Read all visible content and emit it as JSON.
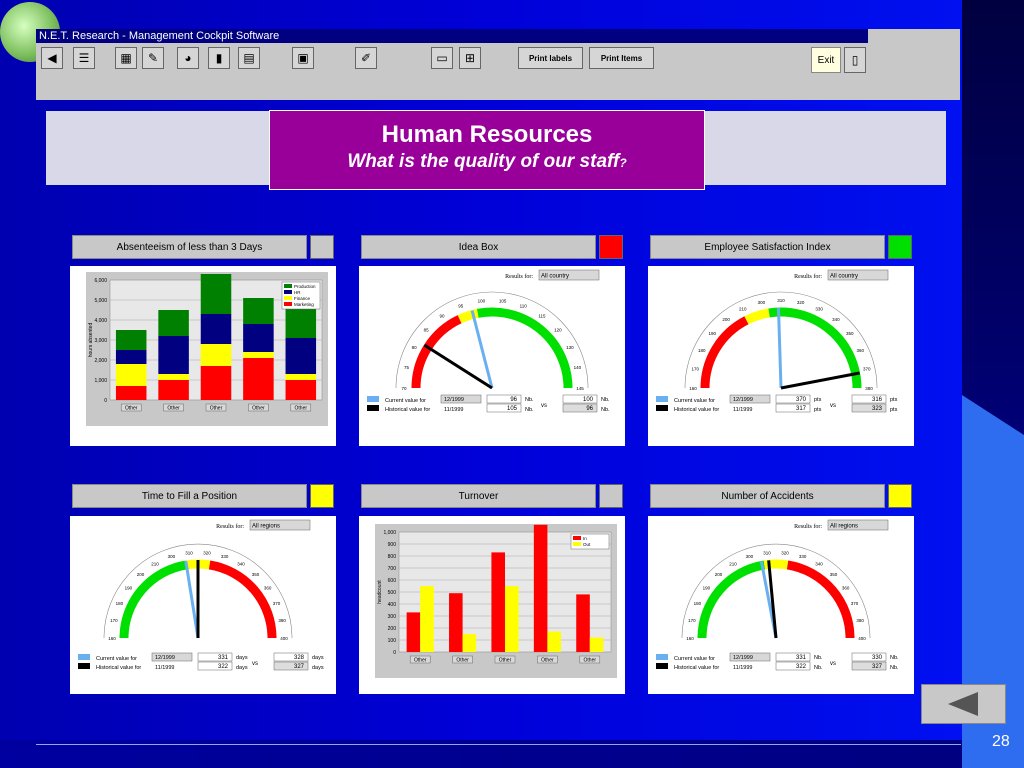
{
  "app": {
    "window_title": "N.E.T. Research - Management Cockpit Software",
    "print_labels": "Print labels",
    "print_items": "Print Items",
    "exit_label": "Exit"
  },
  "slide": {
    "title": "Human Resources",
    "subtitle": "What is the quality of our staff",
    "subtitle_mark": "?",
    "page_number": "28"
  },
  "panels": {
    "absenteeism": {
      "label": "Absenteeism of less than 3 Days",
      "status_color": "#c8c8c8"
    },
    "idea_box": {
      "label": "Idea Box",
      "status_color": "#ff0000"
    },
    "satisfaction": {
      "label": "Employee Satisfaction Index",
      "status_color": "#00e000"
    },
    "time_to_fill": {
      "label": "Time to Fill a Position",
      "status_color": "#ffff00"
    },
    "turnover": {
      "label": "Turnover",
      "status_color": "#c8c8c8"
    },
    "accidents": {
      "label": "Number of Accidents",
      "status_color": "#ffff00"
    }
  },
  "gauges": {
    "idea_box": {
      "results_label": "Results for:",
      "results_value": "All country",
      "ticks": [
        "70",
        "75",
        "80",
        "85",
        "90",
        "95",
        "100",
        "105",
        "110",
        "115",
        "120",
        "130",
        "140",
        "145"
      ],
      "current_label": "Current value for",
      "historical_label": "Historical value for",
      "current_date": "12/1999",
      "historical_date": "11/1999",
      "current_value": "96",
      "historical_value": "105",
      "unit": "Nb.",
      "vs": "vs",
      "compare_current": "100",
      "compare_historical": "96",
      "current_fraction": 0.18,
      "historical_fraction": 0.42
    },
    "satisfaction": {
      "results_label": "Results for:",
      "results_value": "All country",
      "ticks": [
        "160",
        "170",
        "180",
        "190",
        "200",
        "210",
        "300",
        "310",
        "320",
        "330",
        "340",
        "350",
        "360",
        "370",
        "380"
      ],
      "current_label": "Current value for",
      "historical_label": "Historical value for",
      "current_date": "12/1999",
      "historical_date": "11/1999",
      "current_value": "370",
      "historical_value": "317",
      "unit": "pts",
      "vs": "vs",
      "compare_current": "316",
      "compare_historical": "323",
      "current_fraction": 0.94,
      "historical_fraction": 0.49
    },
    "time_to_fill": {
      "results_label": "Results for:",
      "results_value": "All regions",
      "ticks": [
        "160",
        "170",
        "180",
        "190",
        "200",
        "210",
        "300",
        "310",
        "320",
        "330",
        "340",
        "350",
        "360",
        "370",
        "380",
        "400"
      ],
      "current_label": "Current value for",
      "historical_label": "Historical value for",
      "current_date": "12/1999",
      "historical_date": "11/1999",
      "current_value": "331",
      "historical_value": "322",
      "unit": "days",
      "vs": "vs",
      "compare_current": "328",
      "compare_historical": "327",
      "current_fraction": 0.5,
      "historical_fraction": 0.45
    },
    "accidents": {
      "results_label": "Results for:",
      "results_value": "All regions",
      "ticks": [
        "160",
        "170",
        "180",
        "190",
        "200",
        "210",
        "300",
        "310",
        "320",
        "330",
        "340",
        "350",
        "360",
        "370",
        "380",
        "400"
      ],
      "current_label": "Current value for",
      "historical_label": "Historical value for",
      "current_date": "12/1999",
      "historical_date": "11/1999",
      "current_value": "331",
      "historical_value": "322",
      "unit": "Nb.",
      "vs": "vs",
      "compare_current": "330",
      "compare_historical": "327",
      "current_fraction": 0.47,
      "historical_fraction": 0.44
    }
  },
  "chart_data": [
    {
      "type": "bar",
      "stacked": true,
      "ylabel": "hours absented",
      "categories": [
        "Other",
        "Other",
        "Other",
        "Other",
        "Other"
      ],
      "y_ticks": [
        "0",
        "1,000",
        "2,000",
        "3,000",
        "4,000",
        "5,000",
        "6,000"
      ],
      "ylim": [
        0,
        6000
      ],
      "legend_position": "top-right",
      "series": [
        {
          "name": "Marketing",
          "color": "#ff0000",
          "values": [
            700,
            1000,
            1700,
            2100,
            1000
          ]
        },
        {
          "name": "Finance",
          "color": "#ffff00",
          "values": [
            1100,
            300,
            1100,
            300,
            300
          ]
        },
        {
          "name": "HR",
          "color": "#000080",
          "values": [
            700,
            1900,
            1500,
            1400,
            1800
          ]
        },
        {
          "name": "Production",
          "color": "#008000",
          "values": [
            1000,
            1300,
            2000,
            1300,
            1800
          ]
        }
      ]
    },
    {
      "type": "bar",
      "ylabel": "headcount",
      "categories": [
        "Other",
        "Other",
        "Other",
        "Other",
        "Other"
      ],
      "y_ticks": [
        "0",
        "100",
        "200",
        "300",
        "400",
        "500",
        "600",
        "700",
        "800",
        "900",
        "1,000"
      ],
      "ylim": [
        0,
        1000
      ],
      "legend_position": "top-right",
      "series": [
        {
          "name": "In",
          "color": "#ff0000",
          "values": [
            330,
            490,
            830,
            1060,
            480
          ]
        },
        {
          "name": "Out",
          "color": "#ffff00",
          "values": [
            550,
            150,
            550,
            170,
            120
          ]
        }
      ]
    }
  ]
}
